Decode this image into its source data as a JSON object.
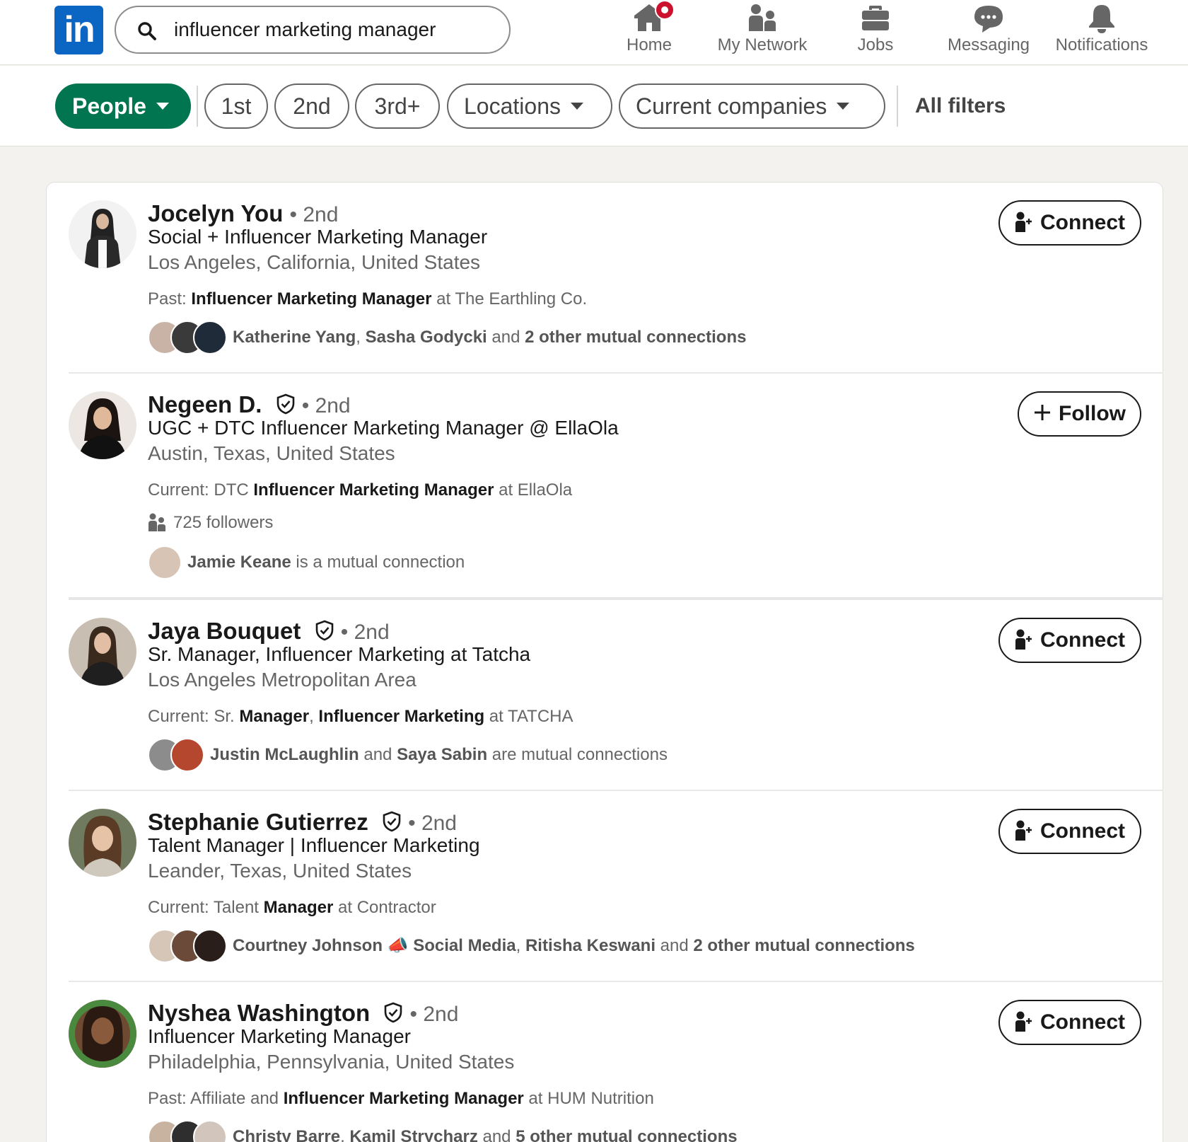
{
  "nav": {
    "logo_text": "in",
    "search_value": "influencer marketing manager",
    "items": [
      {
        "label": "Home",
        "icon": "home-icon"
      },
      {
        "label": "My Network",
        "icon": "network-icon"
      },
      {
        "label": "Jobs",
        "icon": "briefcase-icon"
      },
      {
        "label": "Messaging",
        "icon": "messaging-icon"
      },
      {
        "label": "Notifications",
        "icon": "bell-icon"
      }
    ]
  },
  "filters": {
    "people": "People",
    "first": "1st",
    "second": "2nd",
    "third": "3rd+",
    "locations": "Locations",
    "companies": "Current companies",
    "all": "All filters"
  },
  "colors": {
    "brand": "#0a66c2",
    "active_pill": "#01754f",
    "badge": "#cb112d"
  },
  "results": [
    {
      "name": "Jocelyn You",
      "degree": "2nd",
      "headline": "Social + Influencer Marketing Manager",
      "location": "Los Angeles, California, United States",
      "snippet_pre": "Past: ",
      "snippet_bold": "Influencer Marketing Manager",
      "snippet_post": " at The Earthling Co.",
      "mutual_a": "Katherine Yang",
      "mutual_sep": ", ",
      "mutual_b": "Sasha Godycki",
      "mutual_mid": " and ",
      "mutual_c": "2 other mutual connections",
      "action": "Connect"
    },
    {
      "name": "Negeen D.",
      "degree": "2nd",
      "headline": "UGC + DTC Influencer Marketing Manager @ EllaOla",
      "location": "Austin, Texas, United States",
      "snippet_pre": "Current: DTC ",
      "snippet_bold": "Influencer Marketing Manager",
      "snippet_post": " at EllaOla",
      "followers": "725 followers",
      "mutual_a": "Jamie Keane",
      "mutual_tail": " is a mutual connection",
      "action": "Follow"
    },
    {
      "name": "Jaya Bouquet",
      "degree": "2nd",
      "headline": "Sr. Manager, Influencer Marketing at Tatcha",
      "location": "Los Angeles Metropolitan Area",
      "snippet_pre": "Current: Sr. ",
      "snippet_bold": "Manager",
      "snippet_mid": ", ",
      "snippet_bold2": "Influencer Marketing",
      "snippet_post": " at TATCHA",
      "mutual_a": "Justin McLaughlin",
      "mutual_mid": " and ",
      "mutual_b": "Saya Sabin",
      "mutual_tail": " are mutual connections",
      "action": "Connect"
    },
    {
      "name": "Stephanie Gutierrez",
      "degree": "2nd",
      "headline": "Talent Manager | Influencer Marketing",
      "location": "Leander, Texas, United States",
      "snippet_pre": "Current: Talent ",
      "snippet_bold": "Manager",
      "snippet_post": " at Contractor",
      "mutual_a": "Courtney Johnson 📣 Social Media",
      "mutual_sep": ", ",
      "mutual_b": "Ritisha Keswani",
      "mutual_mid": " and ",
      "mutual_c": "2 other mutual connections",
      "action": "Connect"
    },
    {
      "name": "Nyshea Washington",
      "degree": "2nd",
      "headline": "Influencer Marketing Manager",
      "location": "Philadelphia, Pennsylvania, United States",
      "snippet_pre": "Past: Affiliate and ",
      "snippet_bold": "Influencer Marketing Manager",
      "snippet_post": " at HUM Nutrition",
      "mutual_a": "Christy Barre",
      "mutual_sep": ", ",
      "mutual_b": "Kamil Strycharz",
      "mutual_mid": " and ",
      "mutual_c": "5 other mutual connections",
      "action": "Connect",
      "avatar_frame": "#OPENTOWORK"
    }
  ]
}
